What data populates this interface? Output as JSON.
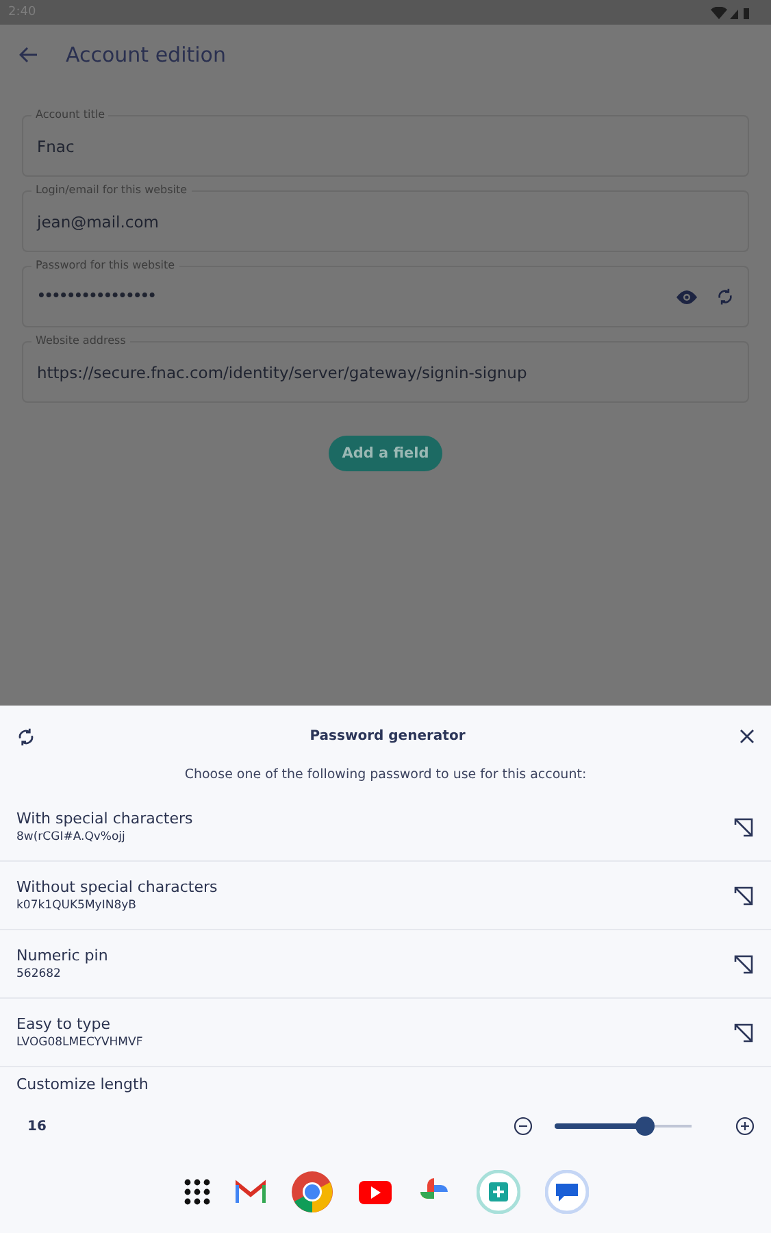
{
  "status_bar": {
    "time": "2:40"
  },
  "app_bar": {
    "title": "Account edition"
  },
  "fields": [
    {
      "label": "Account title",
      "value": "Fnac",
      "kind": "text"
    },
    {
      "label": "Login/email for this website",
      "value": "jean@mail.com",
      "kind": "text"
    },
    {
      "label": "Password for this website",
      "value": "••••••••••••••••",
      "kind": "password"
    },
    {
      "label": "Website address",
      "value": "https://secure.fnac.com/identity/server/gateway/signin-signup",
      "kind": "text"
    }
  ],
  "add_button": "Add a field",
  "sheet": {
    "title": "Password generator",
    "subtitle": "Choose one of the following password to use for this account:",
    "options": [
      {
        "name": "With special characters",
        "password": "8w(rCGI#A.Qv%ojj"
      },
      {
        "name": "Without special characters",
        "password": "k07k1QUK5MyIN8yB"
      },
      {
        "name": "Numeric pin",
        "password": "562682"
      },
      {
        "name": "Easy to type",
        "password": "LVOG08LMECYVHMVF"
      }
    ],
    "length": {
      "label": "Customize length",
      "value": "16",
      "level": 0.66
    }
  }
}
